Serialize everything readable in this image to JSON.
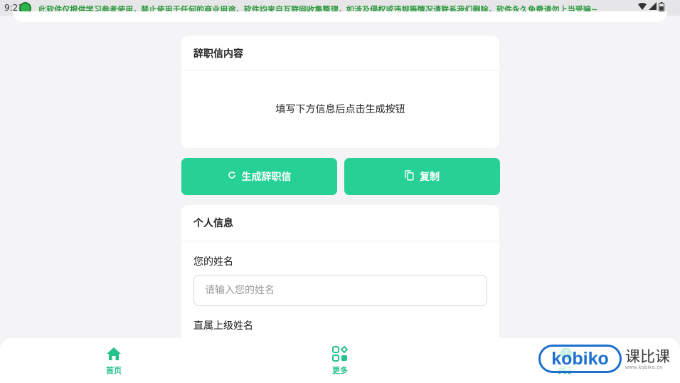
{
  "status_bar": {
    "time": "9:21",
    "banner": "此软件仅提供学习参考使用，禁止使用于任何的商业用途，软件均来自互联网收集整理，如涉及侵权或违规等情况请联系我们删除，软件永久免费请勿上当受骗~",
    "icons": [
      "wifi-icon",
      "signal-icon",
      "battery-icon"
    ]
  },
  "letter_card": {
    "title": "辞职信内容",
    "placeholder_text": "填写下方信息后点击生成按钮"
  },
  "actions": {
    "generate_label": "生成辞职信",
    "copy_label": "复制"
  },
  "info_card": {
    "title": "个人信息",
    "fields": [
      {
        "label": "您的姓名",
        "placeholder": "请输入您的姓名",
        "value": ""
      },
      {
        "label": "直属上级姓名",
        "placeholder": "",
        "value": ""
      }
    ]
  },
  "bottom_nav": {
    "items": [
      {
        "label": "首页",
        "icon": "home-icon"
      },
      {
        "label": "更多",
        "icon": "apps-icon"
      },
      {
        "label": "关于",
        "icon": "info-icon"
      }
    ]
  },
  "watermark": {
    "logo": "kobiko",
    "name": "课比课",
    "url": "www.kobiko.cn"
  },
  "colors": {
    "accent": "#27d196",
    "nav_active": "#27c18a",
    "background": "#f4f4f6"
  }
}
